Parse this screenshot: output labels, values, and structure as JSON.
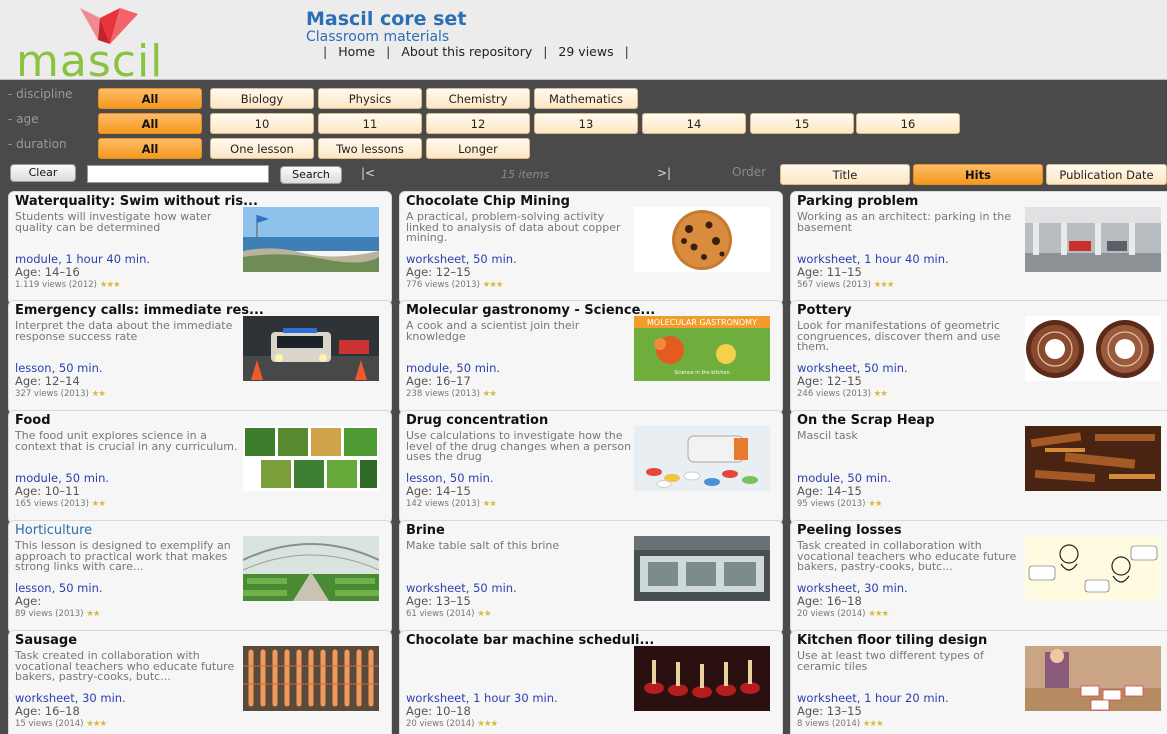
{
  "brand": {
    "logo_text": "mascil",
    "title": "Mascil core set",
    "subtitle": "Classroom materials"
  },
  "nav": {
    "sep": "|",
    "home": "Home",
    "about": "About this repository",
    "views": "29 views"
  },
  "filters": {
    "discipline": {
      "label": "- discipline",
      "options": [
        "All",
        "Biology",
        "Physics",
        "Chemistry",
        "Mathematics"
      ]
    },
    "age": {
      "label": "- age",
      "options": [
        "All",
        "10",
        "11",
        "12",
        "13",
        "14",
        "15",
        "16"
      ]
    },
    "duration": {
      "label": "- duration",
      "options": [
        "All",
        "One lesson",
        "Two lessons",
        "Longer"
      ]
    }
  },
  "controls": {
    "clear": "Clear",
    "search_value": "",
    "search": "Search",
    "first": "|<",
    "count": "15 items",
    "last": ">|",
    "order_label": "Order",
    "order_options": [
      "Title",
      "Hits",
      "Publication Date"
    ]
  },
  "accent_colors": {
    "chip_active": "#f6991d",
    "chip": "#fde7c2",
    "logo_green": "#8bc23f",
    "logo_red": "#e8323c",
    "title_blue": "#2a6eb6"
  },
  "cards": [
    {
      "title": "Waterquality: Swim without ris...",
      "desc": "Students will investigate how water quality can be determined",
      "type": "module, 1 hour 40 min.",
      "age": "Age: 14–16",
      "views": "1.119 views (2012)",
      "stars": "★★★",
      "image": "beach-photo"
    },
    {
      "title": "Chocolate Chip Mining",
      "desc": "A practical, problem-solving activity linked to analysis of data about copper mining.",
      "type": "worksheet, 50 min.",
      "age": "Age: 12–15",
      "views": "776 views (2013)",
      "stars": "★★★",
      "image": "cookie-photo"
    },
    {
      "title": "Parking problem",
      "desc": "Working as an architect: parking in the basement",
      "type": "worksheet, 1 hour 40 min.",
      "age": "Age: 11–15",
      "views": "567 views (2013)",
      "stars": "★★★",
      "image": "parking-garage-photo"
    },
    {
      "title": "Emergency calls: immediate res...",
      "desc": "Interpret the data about the immediate response success rate",
      "type": "lesson, 50 min.",
      "age": "Age: 12–14",
      "views": "327 views (2013)",
      "stars": "★★",
      "image": "police-car-photo"
    },
    {
      "title": "Molecular gastronomy - Science...",
      "desc": "A cook and a scientist join their knowledge",
      "type": "module, 50 min.",
      "age": "Age: 16–17",
      "views": "238 views (2013)",
      "stars": "★★",
      "image": "molecular-gastronomy-book",
      "image_text": "MOLECULAR GASTRONOMY",
      "image_caption": "Science in the kitchen"
    },
    {
      "title": "Pottery",
      "desc": "Look for manifestations of geometric congruences, discover them and use them.",
      "type": "worksheet, 50 min.",
      "age": "Age: 12–15",
      "views": "246 views (2013)",
      "stars": "★★",
      "image": "pottery-plates"
    },
    {
      "title": "Food",
      "desc": "The food unit explores science in a context that is crucial in any curriculum.",
      "type": "module, 50 min.",
      "age": "Age: 10–11",
      "views": "165 views (2013)",
      "stars": "★★",
      "image": "vegetables-grid"
    },
    {
      "title": "Drug concentration",
      "desc": "Use calculations to investigate how the level of the drug changes when a person uses the drug",
      "type": "lesson, 50 min.",
      "age": "Age: 14–15",
      "views": "142 views (2013)",
      "stars": "★★",
      "image": "pills-photo"
    },
    {
      "title": "On the Scrap Heap",
      "desc": "Mascil task",
      "type": "module, 50 min.",
      "age": "Age: 14–15",
      "views": "95 views (2013)",
      "stars": "★★",
      "image": "scrap-metal-photo"
    },
    {
      "title": "Horticulture",
      "desc": "This lesson is designed to exemplify an approach to practical work that makes strong links with care...",
      "type": "lesson, 50 min.",
      "age": "Age:",
      "views": "89 views (2013)",
      "stars": "★★",
      "image": "greenhouse-photo",
      "title_link": true
    },
    {
      "title": "Brine",
      "desc": "Make table salt of this brine",
      "type": "worksheet, 50 min.",
      "age": "Age: 13–15",
      "views": "61 views (2014)",
      "stars": "★★",
      "image": "brine-pans-photo"
    },
    {
      "title": "Peeling losses",
      "desc": "Task created in collaboration with vocational teachers who educate future bakers, pastry-cooks, butc...",
      "type": "worksheet, 30 min.",
      "age": "Age: 16–18",
      "views": "20 views (2014)",
      "stars": "★★★",
      "image": "cartoon-sketch"
    },
    {
      "title": "Sausage",
      "desc": "Task created in collaboration with vocational teachers who educate future bakers, pastry-cooks, butc...",
      "type": "worksheet, 30 min.",
      "age": "Age: 16–18",
      "views": "15 views (2014)",
      "stars": "★★★",
      "image": "sausages-photo"
    },
    {
      "title": "Chocolate bar machine scheduli...",
      "desc": "",
      "type": "worksheet, 1 hour 30 min.",
      "age": "Age: 10–18",
      "views": "20 views (2014)",
      "stars": "★★★",
      "image": "chocolate-machine-photo"
    },
    {
      "title": "Kitchen floor tiling design",
      "desc": "Use at least two different types of ceramic tiles",
      "type": "worksheet, 1 hour 20 min.",
      "age": "Age: 13–15",
      "views": "8 views (2014)",
      "stars": "★★★",
      "image": "tiling-photo"
    }
  ]
}
